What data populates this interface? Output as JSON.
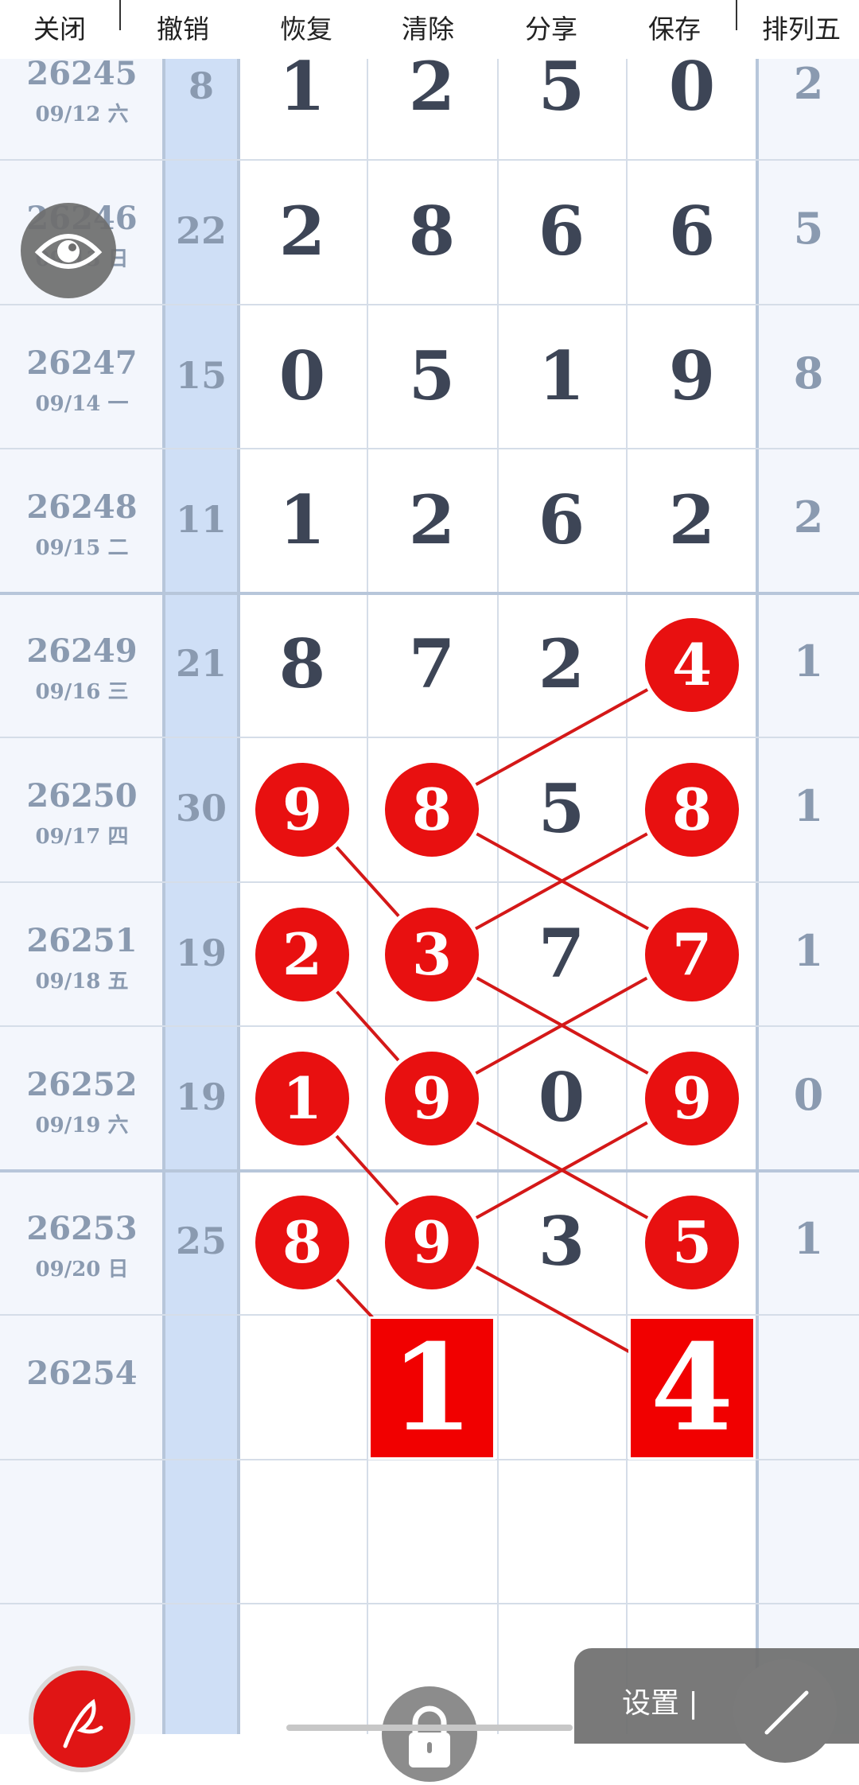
{
  "toolbar": {
    "close": "关闭",
    "undo": "撤销",
    "redo": "恢复",
    "clear": "清除",
    "share": "分享",
    "save": "保存",
    "game": "排列五"
  },
  "rows": [
    {
      "issue": "26245",
      "date": "09/12 六",
      "sum": "8",
      "digits": [
        "1",
        "2",
        "5",
        "0"
      ],
      "tail": "2",
      "hits": [
        false,
        false,
        false,
        false
      ]
    },
    {
      "issue": "26246",
      "date": "09/13 日",
      "sum": "22",
      "digits": [
        "2",
        "8",
        "6",
        "6"
      ],
      "tail": "5",
      "hits": [
        false,
        false,
        false,
        false
      ]
    },
    {
      "issue": "26247",
      "date": "09/14 一",
      "sum": "15",
      "digits": [
        "0",
        "5",
        "1",
        "9"
      ],
      "tail": "8",
      "hits": [
        false,
        false,
        false,
        false
      ]
    },
    {
      "issue": "26248",
      "date": "09/15 二",
      "sum": "11",
      "digits": [
        "1",
        "2",
        "6",
        "2"
      ],
      "tail": "2",
      "hits": [
        false,
        false,
        false,
        false
      ]
    },
    {
      "issue": "26249",
      "date": "09/16 三",
      "sum": "21",
      "digits": [
        "8",
        "7",
        "2",
        "4"
      ],
      "tail": "1",
      "hits": [
        false,
        false,
        false,
        true
      ]
    },
    {
      "issue": "26250",
      "date": "09/17 四",
      "sum": "30",
      "digits": [
        "9",
        "8",
        "5",
        "8"
      ],
      "tail": "1",
      "hits": [
        true,
        true,
        false,
        true
      ]
    },
    {
      "issue": "26251",
      "date": "09/18 五",
      "sum": "19",
      "digits": [
        "2",
        "3",
        "7",
        "7"
      ],
      "tail": "1",
      "hits": [
        true,
        true,
        false,
        true
      ]
    },
    {
      "issue": "26252",
      "date": "09/19 六",
      "sum": "19",
      "digits": [
        "1",
        "9",
        "0",
        "9"
      ],
      "tail": "0",
      "hits": [
        true,
        true,
        false,
        true
      ]
    },
    {
      "issue": "26253",
      "date": "09/20 日",
      "sum": "25",
      "digits": [
        "8",
        "9",
        "3",
        "5"
      ],
      "tail": "1",
      "hits": [
        true,
        true,
        false,
        true
      ]
    }
  ],
  "prediction": {
    "issue": "26254",
    "values": [
      "1",
      "4"
    ]
  },
  "controls": {
    "settings": "设置 |",
    "icons": [
      "eye-icon",
      "pen-icon",
      "lock-icon",
      "draw-line-icon"
    ]
  },
  "colors": {
    "hit": "#e81010",
    "prediction": "#f10000",
    "lines": "#d41818",
    "sum_column": "#cfdff6"
  }
}
